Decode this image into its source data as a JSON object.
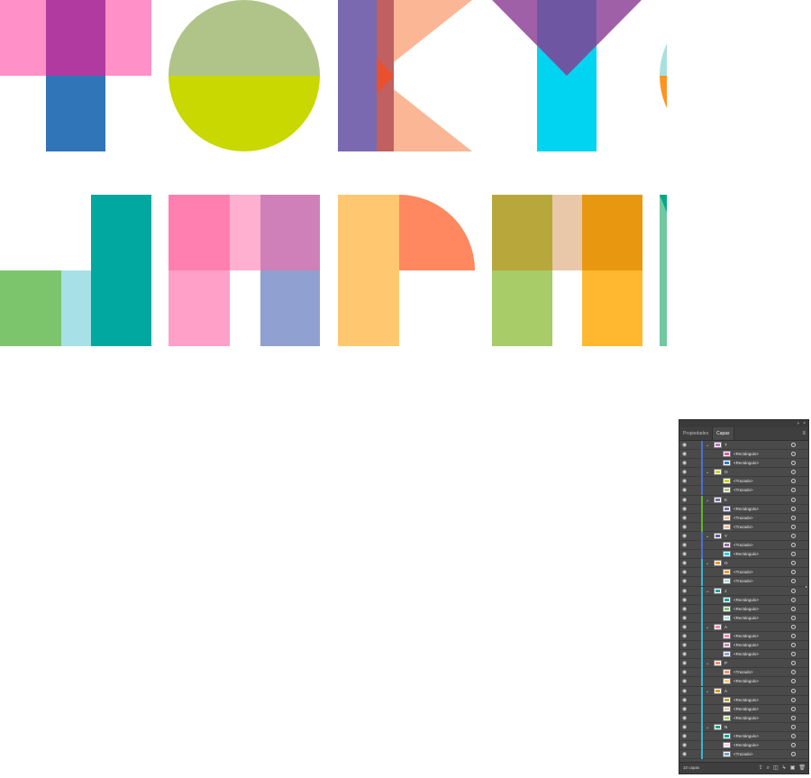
{
  "artboard": {
    "letters": [
      "T",
      "O",
      "K",
      "Y",
      "O",
      "J",
      "A",
      "P",
      "A",
      "N"
    ]
  },
  "panel": {
    "tabs": [
      "Propiedades",
      "Capas"
    ],
    "active_tab": "Capas",
    "menu_icon": "hamburger-menu-icon",
    "footer_count": "10 capas",
    "footer_icons": [
      "collect-export-icon",
      "locate-object-icon",
      "make-clipping-mask-icon",
      "new-sublayer-icon",
      "new-layer-icon",
      "delete-icon"
    ],
    "rows": [
      {
        "level": 0,
        "name": "T",
        "color": "#4a6fd8",
        "thumb": "#c86cc8"
      },
      {
        "level": 1,
        "name": "<Rectángulo>",
        "color": "#4a6fd8",
        "thumb": "#e0589f"
      },
      {
        "level": 1,
        "name": "<Rectángulo>",
        "color": "#4a6fd8",
        "thumb": "#2f78c4"
      },
      {
        "level": 0,
        "name": "O",
        "color": "#4a6fd8",
        "thumb": "#c8d800"
      },
      {
        "level": 1,
        "name": "<Trazado>",
        "color": "#4a6fd8",
        "thumb": "#c8d800"
      },
      {
        "level": 1,
        "name": "<Trazado>",
        "color": "#4a6fd8",
        "thumb": "#b0c48a"
      },
      {
        "level": 0,
        "name": "K",
        "color": "#5eb82a",
        "thumb": "#7a68b0"
      },
      {
        "level": 1,
        "name": "<Rectángulo>",
        "color": "#5eb82a",
        "thumb": "#7a68b0"
      },
      {
        "level": 1,
        "name": "<Trazado>",
        "color": "#5eb82a",
        "thumb": "#fbb696"
      },
      {
        "level": 1,
        "name": "<Trazado>",
        "color": "#5eb82a",
        "thumb": "#fbb696"
      },
      {
        "level": 0,
        "name": "Y",
        "color": "#4a6fd8",
        "thumb": "#6f56a3"
      },
      {
        "level": 1,
        "name": "<Trazado>",
        "color": "#4a6fd8",
        "thumb": "#a060a8"
      },
      {
        "level": 1,
        "name": "<Rectángulo>",
        "color": "#4a6fd8",
        "thumb": "#00d4f0"
      },
      {
        "level": 0,
        "name": "O",
        "color": "#36b6d8",
        "thumb": "#ff9422"
      },
      {
        "level": 1,
        "name": "<Trazado>",
        "color": "#36b6d8",
        "thumb": "#ff9422"
      },
      {
        "level": 1,
        "name": "<Trazado>",
        "color": "#36b6d8",
        "thumb": "#a8e0e0"
      },
      {
        "level": 0,
        "name": "J",
        "color": "#36b6d8",
        "thumb": "#00a8a0"
      },
      {
        "level": 1,
        "name": "<Rectángulo>",
        "color": "#36b6d8",
        "thumb": "#00a8a0"
      },
      {
        "level": 1,
        "name": "<Rectángulo>",
        "color": "#36b6d8",
        "thumb": "#7dc56c"
      },
      {
        "level": 1,
        "name": "<Rectángulo>",
        "color": "#36b6d8",
        "thumb": "#a8e0e8"
      },
      {
        "level": 0,
        "name": "A",
        "color": "#36b6d8",
        "thumb": "#ff80b0"
      },
      {
        "level": 1,
        "name": "<Rectángulo>",
        "color": "#36b6d8",
        "thumb": "#ff80b0"
      },
      {
        "level": 1,
        "name": "<Rectángulo>",
        "color": "#36b6d8",
        "thumb": "#d080b8"
      },
      {
        "level": 1,
        "name": "<Rectángulo>",
        "color": "#36b6d8",
        "thumb": "#90a0d0"
      },
      {
        "level": 0,
        "name": "P",
        "color": "#36b6d8",
        "thumb": "#ff8860"
      },
      {
        "level": 1,
        "name": "<Trazado>",
        "color": "#36b6d8",
        "thumb": "#ff8860"
      },
      {
        "level": 1,
        "name": "<Rectángulo>",
        "color": "#36b6d8",
        "thumb": "#ffc870"
      },
      {
        "level": 0,
        "name": "A",
        "color": "#36b6d8",
        "thumb": "#e89810"
      },
      {
        "level": 1,
        "name": "<Rectángulo>",
        "color": "#36b6d8",
        "thumb": "#b8a83c"
      },
      {
        "level": 1,
        "name": "<Rectángulo>",
        "color": "#36b6d8",
        "thumb": "#e8c8a8"
      },
      {
        "level": 1,
        "name": "<Rectángulo>",
        "color": "#36b6d8",
        "thumb": "#a8cc68"
      },
      {
        "level": 0,
        "name": "N",
        "color": "#36b6d8",
        "thumb": "#00a888"
      },
      {
        "level": 1,
        "name": "<Rectángulo>",
        "color": "#36b6d8",
        "thumb": "#00a888"
      },
      {
        "level": 1,
        "name": "<Rectángulo>",
        "color": "#36b6d8",
        "thumb": "#ffd0e8"
      },
      {
        "level": 1,
        "name": "<Trazado>",
        "color": "#36b6d8",
        "thumb": "#70a0d0"
      }
    ]
  }
}
